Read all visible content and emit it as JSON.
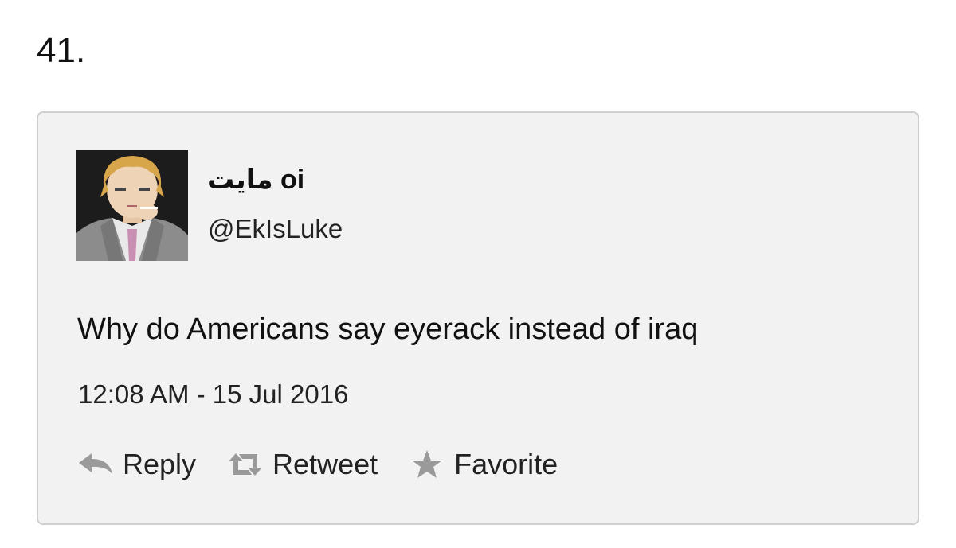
{
  "list": {
    "number": "41."
  },
  "tweet": {
    "display_name": "مايت oi",
    "handle": "@EkIsLuke",
    "text": "Why do Americans say eyerack instead of iraq",
    "timestamp": "12:08 AM - 15 Jul 2016",
    "avatar_icon": "avatar-anime-man-in-suit"
  },
  "actions": {
    "reply_label": "Reply",
    "retweet_label": "Retweet",
    "favorite_label": "Favorite",
    "icon_color": "#9a9a9a"
  }
}
